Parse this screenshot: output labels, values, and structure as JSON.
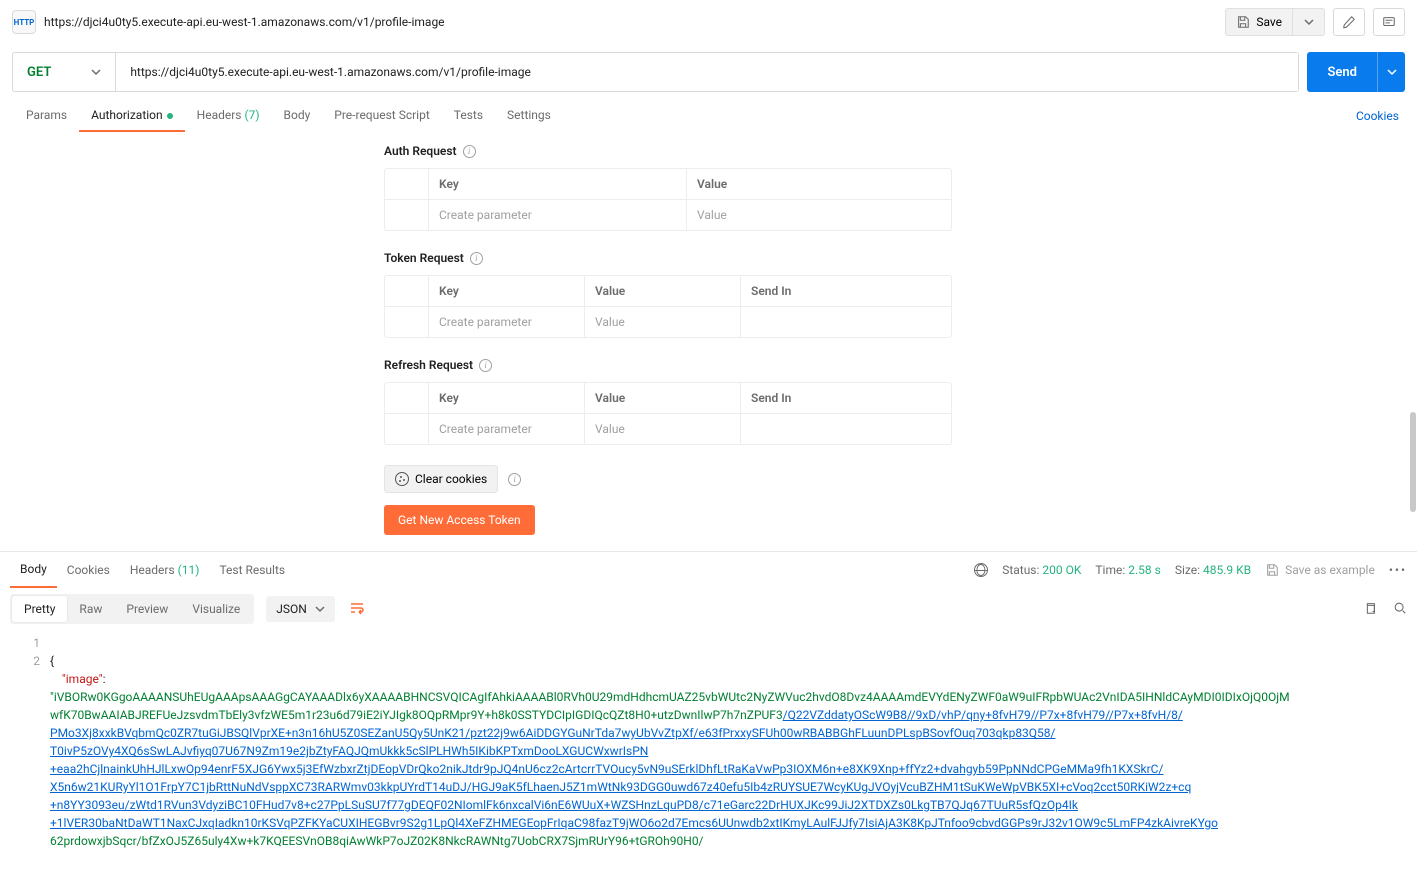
{
  "breadcrumb": "https://djci4u0ty5.execute-api.eu-west-1.amazonaws.com/v1/profile-image",
  "save_label": "Save",
  "request": {
    "method": "GET",
    "url": "https://djci4u0ty5.execute-api.eu-west-1.amazonaws.com/v1/profile-image",
    "send_label": "Send"
  },
  "tabs": {
    "params": "Params",
    "auth": "Authorization",
    "headers": "Headers",
    "headers_count": "(7)",
    "body": "Body",
    "prereq": "Pre-request Script",
    "tests": "Tests",
    "settings": "Settings",
    "cookies": "Cookies"
  },
  "auth": {
    "auth_req": "Auth Request",
    "token_req": "Token Request",
    "refresh_req": "Refresh Request",
    "key_header": "Key",
    "value_header": "Value",
    "sendin_header": "Send In",
    "key_placeholder": "Create parameter",
    "value_placeholder": "Value",
    "clear_cookies": "Clear cookies",
    "get_token": "Get New Access Token"
  },
  "response": {
    "tabs": {
      "body": "Body",
      "cookies": "Cookies",
      "headers": "Headers",
      "headers_count": "(11)",
      "tests": "Test Results"
    },
    "status_label": "Status:",
    "status_value": "200 OK",
    "time_label": "Time:",
    "time_value": "2.58 s",
    "size_label": "Size:",
    "size_value": "485.9 KB",
    "save_example": "Save as example",
    "format": {
      "pretty": "Pretty",
      "raw": "Raw",
      "preview": "Preview",
      "visualize": "Visualize",
      "type": "JSON"
    },
    "json": {
      "image_key": "\"image\"",
      "line1": "\"iVBORw0KGgoAAAANSUhEUgAAApsAAAGgCAYAAADlx6yXAAAABHNCSVQICAgIfAhkiAAAABl0RVh0U29mdHdhcmUAZ25vbWUtc2NyZWVuc2hvdO8Dvz4AAAAmdEVYdENyZWF0aW9uIFRpbWUAc2VnIDA5IHNldCAyMDI0IDIxOjQ0OjM",
      "line2": "wfK70BwAAIABJREFUeJzsvdmTbEly3vfzWE5m1r23u6d79iE2iYJIgk8OQpRMpr9Y+h8k0SSTYDCIpIGDIQcQZt8H0+utzDwnIlwP7h7nZPUF3",
      "line2_link": "/Q22VZddatyOScW9B8//9xD/vhP/qny+8fvH79//P7x+8fvH79//P7x+8fvH/8/",
      "line3_link": "PMo3Xj8xxkBVqbmQc0ZR7tuGiJBSQlVprXE+n3n16hU5Z0SEZanU5Qy5UnK21/pzt22j9w6AiDDGYGuNrTda7wyUbVvZtpXf/e63fPrxxySFUh00wRBABBGhFLuunDPLspBSovfOuq703qkp83Q58/",
      "line4_link": "T0ivP5zOVy4XQ6sSwLAJvfiyq07U67N9Zm19e2jbZtyFAQJQmUkkk5cSlPLHWh5IKibKPTxmDooLXGUCWxwrIsPN",
      "line5_link": "+eaa2hCjlnainkUhHJlLxwOp94enrF5XJG6Ywx5j3EfWzbxrZtjDEopVDrQko2nikJtdr9pJQ4nU6cz2cArtcrrTVOucy5vN9uSErklDhfLtRaKaVwPp3IOXM6n+e8XK9Xnp+ffYz2+dvahgyb59PpNNdCPGeMMa9fh1KXSkrC/",
      "line6_link": "X5n6w21KURyYl1O1FrpY7C1jbRttNuNdVsppXC73RARWmv03kkpUYrdT14uDJ/HGJ9aK5fLhaenJ5Z1mWtNk93DGG0uwd67z40efu5Ib4zRUYSUE7WcyKUgJVOyjVcuBZHM1tSuKWeWpVBK5XI+cVoq2cct50RKiW2z+cq",
      "line7_link": "+n8YY3093eu/zWtd1RVun3VdyziBC10FHud7v8+c27PpLSuSU7f77gDEQF02NIomlFk6nxcalVi6nE6WUuX+WZSHnzLquPD8/c71eGarc22DrHUXJKc99JiJ2XTDXZs0LkgTB7QJq67TUuR5sfQzOp4Ik",
      "line8_link": "+1lVER30baNtDaWT1NaxCJxqIadkn10rKSVqPZFKYaCUXIHEGBvr9S2g1LpQl4XeFZHMEGEopFrIqaC98fazT9jWO6o2d7Emcs6UUnwdb2xtIKmyLAulFJJfy7IsiAjA3K8KpJTnfoo9cbvdGGPs9rJ32v1OW9c5LmFP4zkAivreKYgo",
      "line9": "62prdowxjbSqcr/bfZxOJ5Z65uly4Xw+k7KQEESVnOB8qiAwWkP7oJZ02K8NkcRAWNtg7UobCRX7SjmRUrY96+tGROh90H0/"
    }
  }
}
